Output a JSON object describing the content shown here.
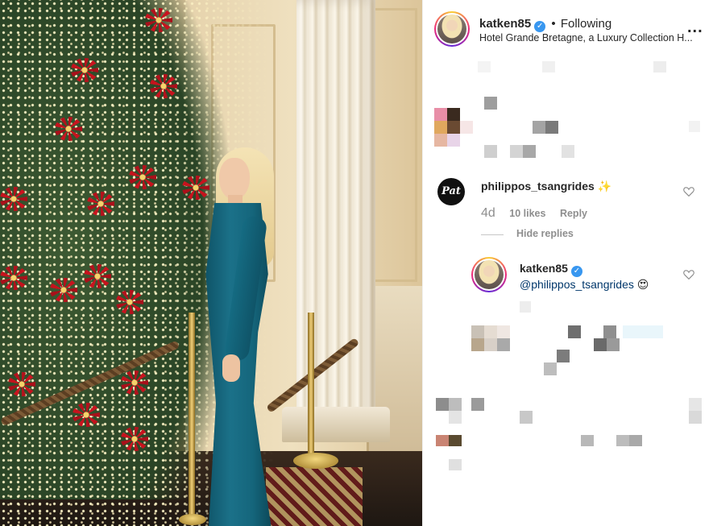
{
  "post": {
    "header": {
      "username": "katken85",
      "separator": "•",
      "follow_status": "Following",
      "location": "Hotel Grande Bretagne, a Luxury Collection H...",
      "more_label": "..."
    }
  },
  "comments": [
    {
      "username": "philippos_tsangrides",
      "emoji": "✨",
      "age": "4d",
      "likes": "10 likes",
      "reply_label": "Reply",
      "hide_replies_label": "Hide replies",
      "avatar_text": "Pat",
      "replies": [
        {
          "username": "katken85",
          "mention": "@philippos_tsangrides",
          "emoji": "😍"
        }
      ]
    }
  ],
  "colors": {
    "accent_blue": "#3897f0",
    "mention_blue": "#00376b",
    "muted_gray": "#8e8e8e",
    "text_dark": "#262626"
  },
  "icons": [
    "verified-badge-icon",
    "more-options-icon",
    "heart-icon"
  ]
}
